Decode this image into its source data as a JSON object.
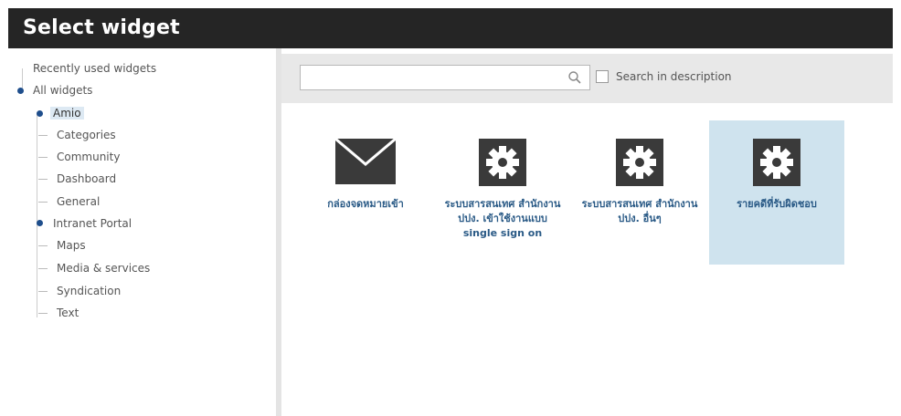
{
  "window": {
    "title": "Select widget"
  },
  "tree": {
    "recently_used": "Recently used widgets",
    "all_widgets": "All widgets",
    "items": [
      {
        "label": "Amio"
      },
      {
        "label": "Categories"
      },
      {
        "label": "Community"
      },
      {
        "label": "Dashboard"
      },
      {
        "label": "General"
      },
      {
        "label": "Intranet Portal"
      },
      {
        "label": "Maps"
      },
      {
        "label": "Media & services"
      },
      {
        "label": "Syndication"
      },
      {
        "label": "Text"
      }
    ]
  },
  "search": {
    "value": "",
    "placeholder": "",
    "checkbox_label": "Search in description",
    "checked": false
  },
  "widgets": [
    {
      "name": "กล่องจดหมายเข้า",
      "icon": "envelope-icon"
    },
    {
      "name": "ระบบสารสนเทศ สำนักงาน ปปง. เข้าใช้งานแบบ single sign on",
      "icon": "gear-icon"
    },
    {
      "name": "ระบบสารสนเทศ สำนักงาน ปปง. อื่นๆ",
      "icon": "gear-icon"
    },
    {
      "name": "รายคดีที่รับผิดชอบ",
      "icon": "gear-icon"
    }
  ],
  "colors": {
    "titlebar": "#252525",
    "accent": "#1f4e8c",
    "selected_tile": "#cfe3ee",
    "toolbar": "#e8e8e8"
  }
}
